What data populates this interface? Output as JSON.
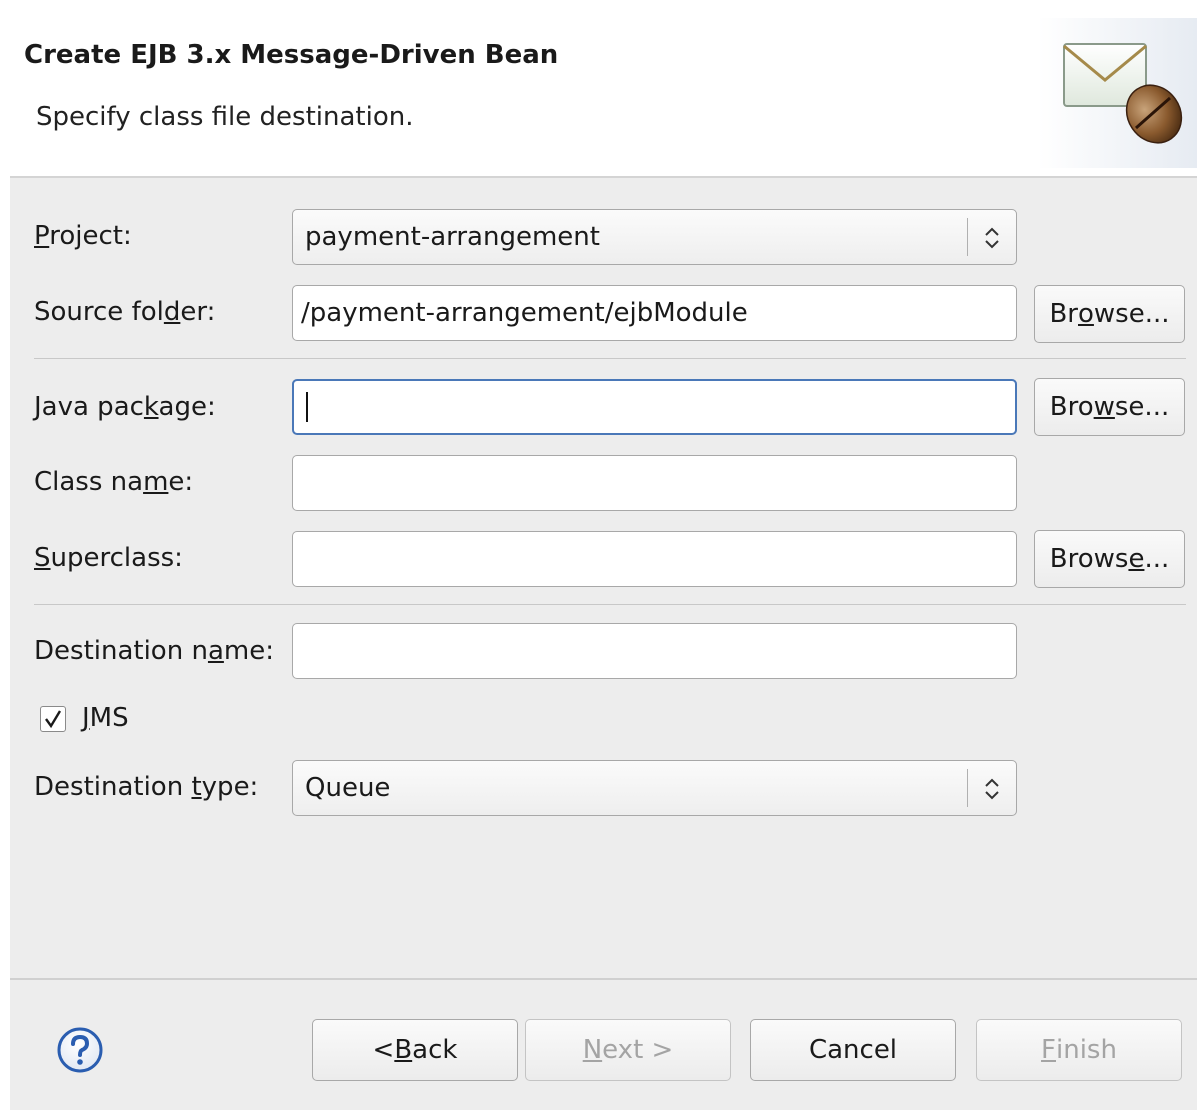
{
  "header": {
    "title": "Create EJB 3.x Message-Driven Bean",
    "description": "Specify class file destination."
  },
  "form": {
    "project": {
      "label_pre": "",
      "label_mnemonic": "P",
      "label_post": "roject:",
      "value": "payment-arrangement"
    },
    "source_folder": {
      "label_pre": "Source fol",
      "label_mnemonic": "d",
      "label_post": "er:",
      "value": "/payment-arrangement/ejbModule",
      "browse_pre": "Br",
      "browse_mnemonic": "o",
      "browse_post": "wse..."
    },
    "java_package": {
      "label_pre": "Java pac",
      "label_mnemonic": "k",
      "label_post": "age:",
      "value": "",
      "browse_pre": "Bro",
      "browse_mnemonic": "w",
      "browse_post": "se..."
    },
    "class_name": {
      "label_pre": "Class na",
      "label_mnemonic": "m",
      "label_post": "e:",
      "value": ""
    },
    "superclass": {
      "label_pre": "",
      "label_mnemonic": "S",
      "label_post": "uperclass:",
      "value": "",
      "browse_pre": "Brows",
      "browse_mnemonic": "e",
      "browse_post": "..."
    },
    "destination_name": {
      "label_pre": "Destination n",
      "label_mnemonic": "a",
      "label_post": "me:",
      "value": ""
    },
    "jms": {
      "label_pre": "",
      "label_mnemonic": "J",
      "label_post": "MS",
      "checked": true
    },
    "destination_type": {
      "label_pre": "Destination ",
      "label_mnemonic": "t",
      "label_post": "ype:",
      "value": "Queue"
    }
  },
  "footer": {
    "back": {
      "pre": "< ",
      "mnemonic": "B",
      "post": "ack"
    },
    "next": {
      "pre": "",
      "mnemonic": "N",
      "post": "ext >",
      "enabled": false
    },
    "cancel": {
      "label": "Cancel"
    },
    "finish": {
      "pre": "",
      "mnemonic": "F",
      "post": "inish",
      "enabled": false
    }
  },
  "icons": {
    "header_image": "envelope-bean-icon",
    "help": "help-icon",
    "combo_arrow": "up-down-arrows-icon",
    "checkmark": "checkmark-icon"
  },
  "colors": {
    "panel_bg": "#ededed",
    "focus_border": "#4a78b8",
    "help_blue": "#2a5db0"
  }
}
